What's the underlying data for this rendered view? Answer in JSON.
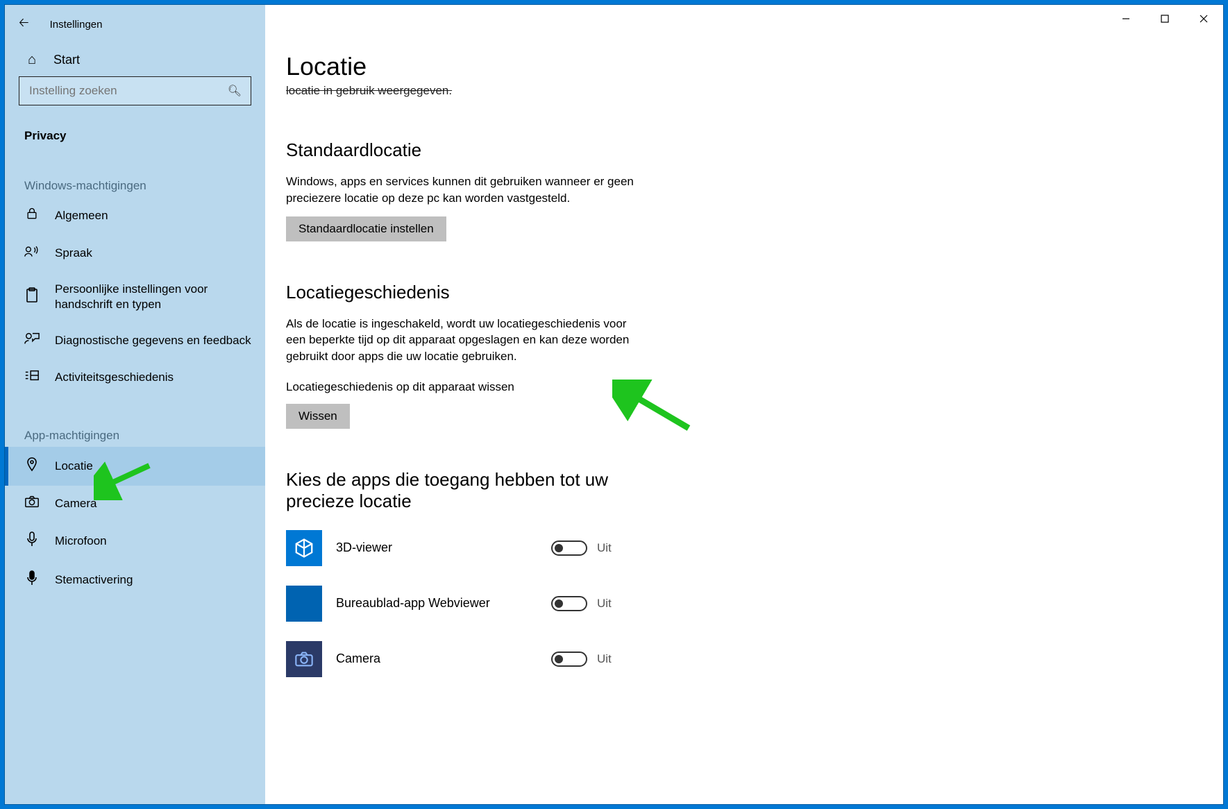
{
  "window": {
    "title": "Instellingen"
  },
  "sidebar": {
    "home": "Start",
    "search_placeholder": "Instelling zoeken",
    "category": "Privacy",
    "groups": [
      {
        "label": "Windows-machtigingen",
        "items": [
          {
            "id": "algemeen",
            "label": "Algemeen",
            "icon": "lock"
          },
          {
            "id": "spraak",
            "label": "Spraak",
            "icon": "speech"
          },
          {
            "id": "handschrift",
            "label": "Persoonlijke instellingen voor handschrift en typen",
            "icon": "clipboard"
          },
          {
            "id": "diagnostiek",
            "label": "Diagnostische gegevens en feedback",
            "icon": "feedback"
          },
          {
            "id": "activiteit",
            "label": "Activiteitsgeschiedenis",
            "icon": "activity"
          }
        ]
      },
      {
        "label": "App-machtigingen",
        "items": [
          {
            "id": "locatie",
            "label": "Locatie",
            "icon": "location",
            "selected": true
          },
          {
            "id": "camera",
            "label": "Camera",
            "icon": "camera"
          },
          {
            "id": "microfoon",
            "label": "Microfoon",
            "icon": "microphone"
          },
          {
            "id": "stemactivering",
            "label": "Stemactivering",
            "icon": "voice"
          }
        ]
      }
    ]
  },
  "page": {
    "title": "Locatie",
    "cut_text": "locatie in gebruik weergegeven.",
    "sections": {
      "default_location": {
        "heading": "Standaardlocatie",
        "text": "Windows, apps en services kunnen dit gebruiken wanneer er geen preciezere locatie op deze pc kan worden vastgesteld.",
        "button": "Standaardlocatie instellen"
      },
      "history": {
        "heading": "Locatiegeschiedenis",
        "text": "Als de locatie is ingeschakeld, wordt uw locatiegeschiedenis voor een beperkte tijd op dit apparaat opgeslagen en kan deze worden gebruikt door apps die uw locatie gebruiken.",
        "subtext": "Locatiegeschiedenis op dit apparaat wissen",
        "button": "Wissen"
      },
      "apps": {
        "heading": "Kies de apps die toegang hebben tot uw precieze locatie",
        "items": [
          {
            "name": "3D-viewer",
            "state": "Uit",
            "icon": "cube"
          },
          {
            "name": "Bureaublad-app Webviewer",
            "state": "Uit",
            "icon": "blank"
          },
          {
            "name": "Camera",
            "state": "Uit",
            "icon": "camera"
          }
        ]
      }
    }
  },
  "annotations": {
    "arrow_color": "#1ec41e"
  }
}
